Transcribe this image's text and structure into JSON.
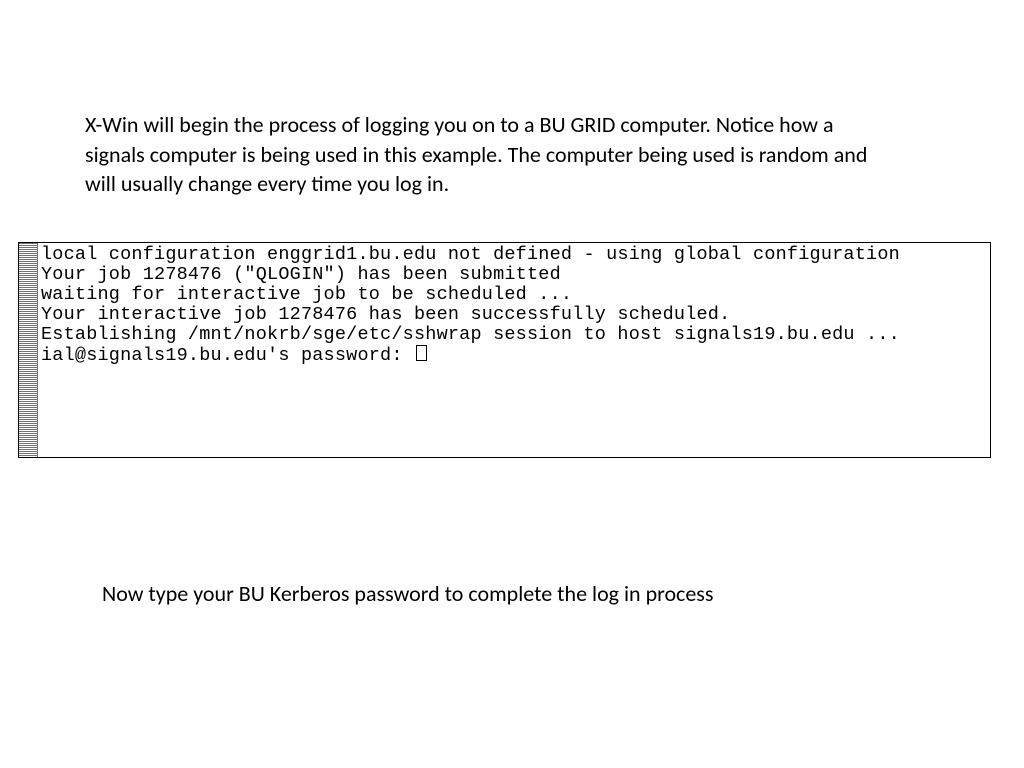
{
  "intro": {
    "text": "X-Win will begin the process of logging you on to a BU GRID computer. Notice how a signals computer is being used in this example. The computer being used is random and will usually change every time you log in."
  },
  "terminal": {
    "lines": [
      "local configuration enggrid1.bu.edu not defined - using global configuration",
      "Your job 1278476 (\"QLOGIN\") has been submitted",
      "waiting for interactive job to be scheduled ...",
      "Your interactive job 1278476 has been successfully scheduled.",
      "Establishing /mnt/nokrb/sge/etc/sshwrap session to host signals19.bu.edu ...",
      "ial@signals19.bu.edu's password: "
    ]
  },
  "instruction": {
    "text": "Now type your BU Kerberos password to complete the log in process"
  }
}
